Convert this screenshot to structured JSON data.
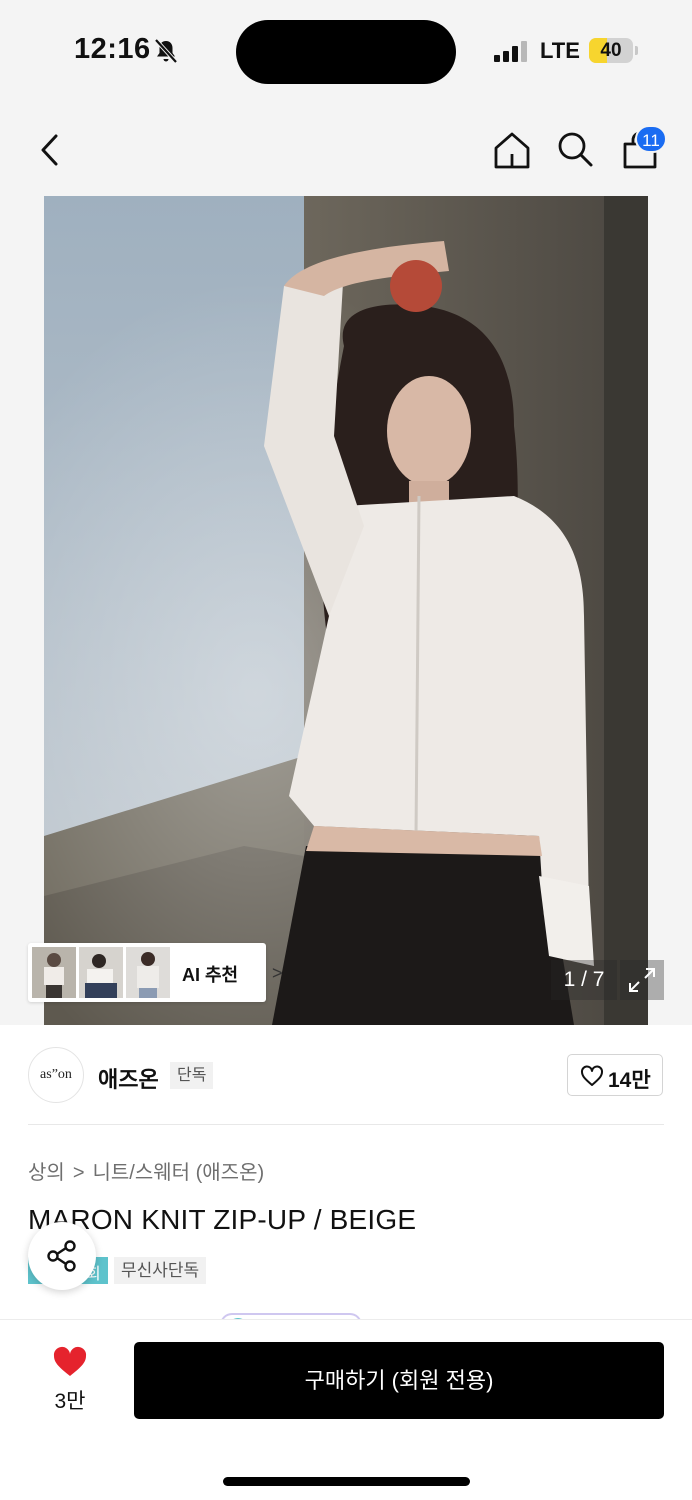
{
  "status_bar": {
    "time": "12:16",
    "network": "LTE",
    "battery_level": "40",
    "battery_fraction": 0.4,
    "signal_bars_active": 3,
    "signal_bars_total": 4,
    "icons": [
      "bell-slash-icon",
      "signal-icon",
      "battery-icon"
    ]
  },
  "nav": {
    "icons": [
      "back-chevron-icon",
      "home-icon",
      "search-icon",
      "shopping-bag-icon"
    ],
    "cart_badge": "11",
    "badge_color": "#1a6cf2"
  },
  "gallery": {
    "counter": "1 / 7",
    "ai_recommend_label": "AI 추천",
    "ai_recommend_chevron": ">",
    "expand_icon": "expand-arrows-icon"
  },
  "brand": {
    "logo_text": "as”on",
    "name": "애즈온",
    "exclusive_tag": "단독",
    "likes": "14만"
  },
  "product": {
    "breadcrumb": [
      "상의",
      "니트/스웨터 (애즈온)"
    ],
    "breadcrumb_separator": ">",
    "title": "MARON KNIT ZIP-UP / BEIGE",
    "tag_teal_partial": "회",
    "tag_exclusive": "무신사단독",
    "tag_teal_color": "#5ec3cc"
  },
  "share": {
    "icon": "share-icon"
  },
  "bottom": {
    "favorite_count": "3만",
    "favorite_icon": "heart-filled-icon",
    "favorite_color": "#e5232d",
    "buy_label": "구매하기 (회원 전용)",
    "buy_color": "#000000"
  }
}
